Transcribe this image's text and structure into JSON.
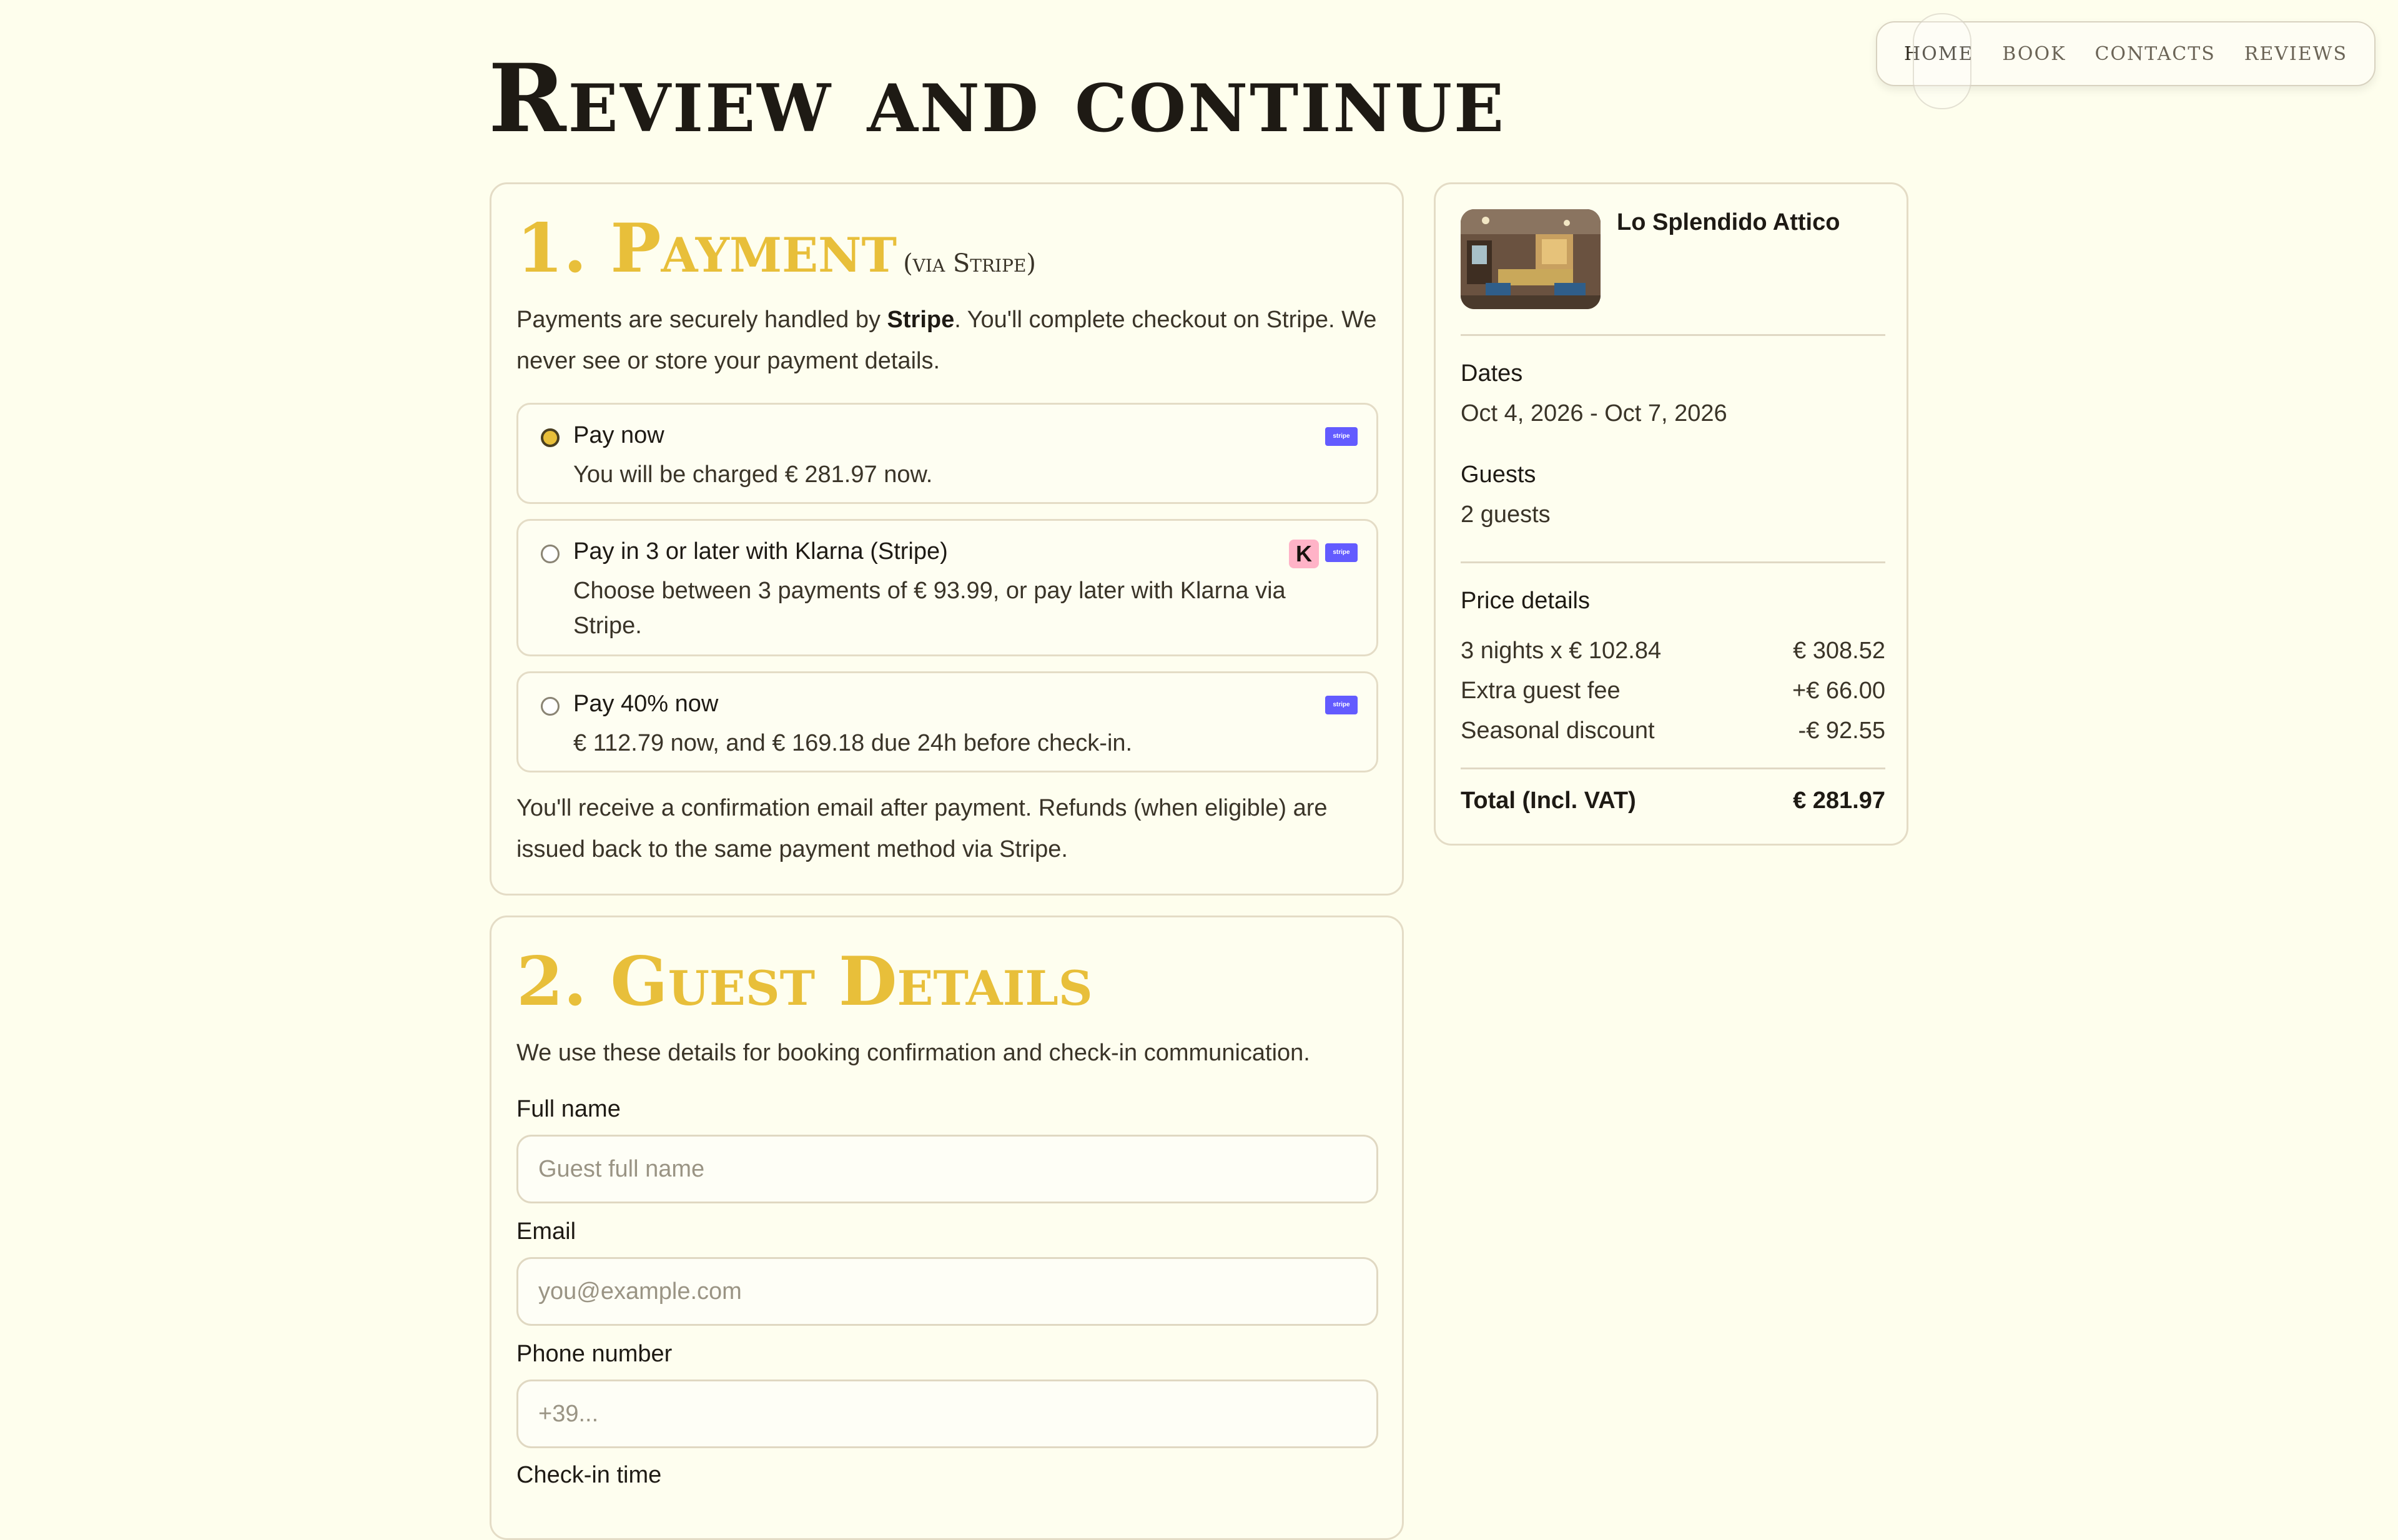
{
  "nav": {
    "items": [
      "HOME",
      "BOOK",
      "CONTACTS",
      "REVIEWS"
    ]
  },
  "page": {
    "title": "Review and continue"
  },
  "payment": {
    "title": "1. Payment",
    "subtitle": "(via Stripe)",
    "intro_before": "Payments are securely handled by ",
    "intro_brand": "Stripe",
    "intro_after": ". You'll complete checkout on Stripe. We never see or store your payment details.",
    "options": [
      {
        "title": "Pay now",
        "desc": "You will be charged € 281.97 now.",
        "selected": true,
        "badges": [
          "stripe"
        ]
      },
      {
        "title": "Pay in 3 or later with Klarna (Stripe)",
        "desc": "Choose between 3 payments of € 93.99, or pay later with Klarna via Stripe.",
        "selected": false,
        "badges": [
          "klarna",
          "stripe"
        ]
      },
      {
        "title": "Pay 40% now",
        "desc": "€ 112.79 now, and € 169.18 due 24h before check-in.",
        "selected": false,
        "badges": [
          "stripe"
        ]
      }
    ],
    "stripe_badge": "stripe",
    "klarna_badge": "K",
    "footer": "You'll receive a confirmation email after payment. Refunds (when eligible) are issued back to the same payment method via Stripe."
  },
  "guest": {
    "title": "2. Guest Details",
    "intro": "We use these details for booking confirmation and check-in communication.",
    "fields": {
      "full_name": {
        "label": "Full name",
        "placeholder": "Guest full name"
      },
      "email": {
        "label": "Email",
        "placeholder": "you@example.com"
      },
      "phone": {
        "label": "Phone number",
        "placeholder": "+39..."
      },
      "checkin": {
        "label": "Check-in time"
      }
    }
  },
  "summary": {
    "property_name": "Lo Splendido Attico",
    "dates_label": "Dates",
    "dates_value": "Oct 4, 2026 - Oct 7, 2026",
    "guests_label": "Guests",
    "guests_value": "2 guests",
    "price_label": "Price details",
    "rows": [
      {
        "label": "3 nights x € 102.84",
        "value": "€ 308.52"
      },
      {
        "label": "Extra guest fee",
        "value": "+€ 66.00"
      },
      {
        "label": "Seasonal discount",
        "value": "-€ 92.55"
      }
    ],
    "total_label": "Total (Incl. VAT)",
    "total_value": "€ 281.97"
  },
  "colors": {
    "background": "#fefeed",
    "accent": "#e8bf3a",
    "stripe": "#635bff",
    "klarna": "#ffb3c7"
  }
}
